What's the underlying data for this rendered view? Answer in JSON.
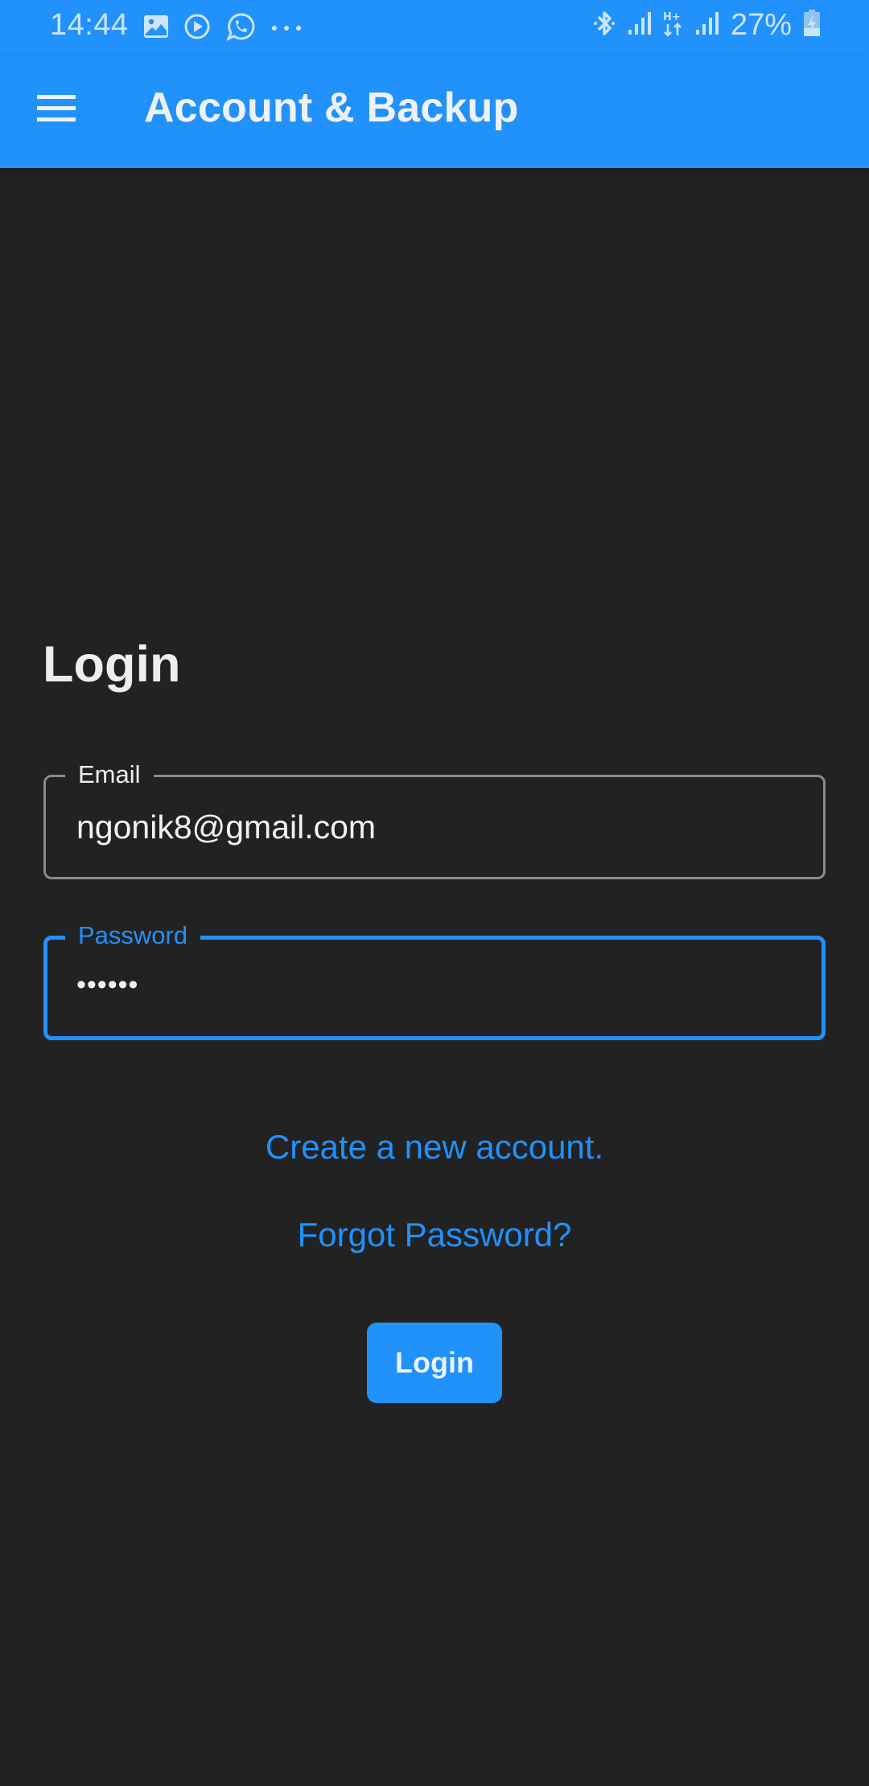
{
  "status_bar": {
    "time": "14:44",
    "left_icons": [
      "gallery-icon",
      "play-icon",
      "whatsapp-icon",
      "more-dots-icon"
    ],
    "right_icons": [
      "bluetooth-icon",
      "signal-icon",
      "h-plus-data-icon",
      "signal-icon",
      "battery-charging-icon"
    ],
    "battery_percent": "27%"
  },
  "app_bar": {
    "menu_icon": "hamburger-menu-icon",
    "title": "Account & Backup"
  },
  "login": {
    "title": "Login",
    "email": {
      "label": "Email",
      "value": "ngonik8@gmail.com"
    },
    "password": {
      "label": "Password",
      "value": "••••••"
    },
    "create_account_link": "Create a new account.",
    "forgot_password_link": "Forgot Password?",
    "login_button": "Login"
  },
  "colors": {
    "accent": "#2191fb",
    "background": "#222222",
    "text": "#eeeeee",
    "field_border_inactive": "#8a8a8a"
  }
}
